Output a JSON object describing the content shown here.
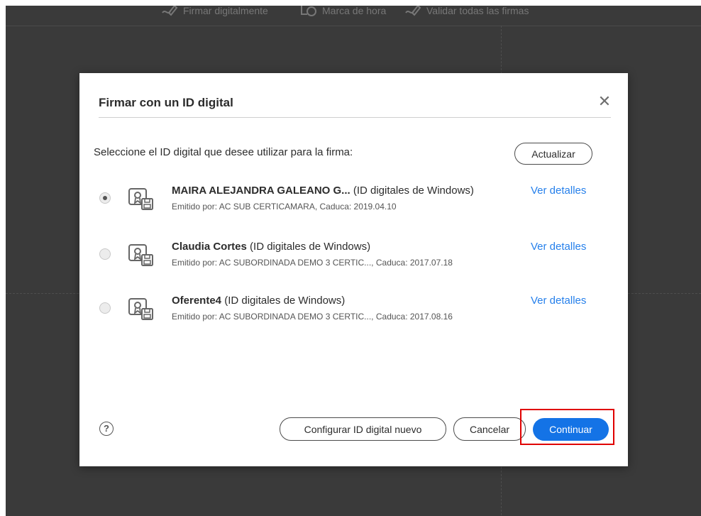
{
  "toolbar": {
    "items": [
      {
        "label": "Firmar digitalmente",
        "icon": "pen-sign-icon"
      },
      {
        "label": "Marca de hora",
        "icon": "clock-stamp-icon"
      },
      {
        "label": "Validar todas las firmas",
        "icon": "pen-sign-check-icon"
      }
    ]
  },
  "dialog": {
    "title": "Firmar con un ID digital",
    "close_icon": "close-icon",
    "prompt": "Seleccione el ID digital que desee utilizar para la firma:",
    "refresh_label": "Actualizar",
    "ids": [
      {
        "name": "MAIRA ALEJANDRA GALEANO G...",
        "type": "(ID digitales de Windows)",
        "issuer": "Emitido por: AC SUB CERTICAMARA, Caduca: 2019.04.10",
        "details": "Ver detalles",
        "selected": true
      },
      {
        "name": "Claudia Cortes",
        "type": "(ID digitales de Windows)",
        "issuer": "Emitido por: AC SUBORDINADA DEMO 3 CERTIC..., Caduca: 2017.07.18",
        "details": "Ver detalles",
        "selected": false
      },
      {
        "name": "Oferente4",
        "type": "(ID digitales de Windows)",
        "issuer": "Emitido por: AC SUBORDINADA DEMO 3 CERTIC..., Caduca: 2017.08.16",
        "details": "Ver detalles",
        "selected": false
      }
    ],
    "help_icon": "?",
    "configure_label": "Configurar ID digital nuevo",
    "cancel_label": "Cancelar",
    "continue_label": "Continuar"
  },
  "colors": {
    "accent": "#1473e6",
    "link": "#2680eb",
    "highlight": "#e00000",
    "background": "#3a3a3a"
  }
}
